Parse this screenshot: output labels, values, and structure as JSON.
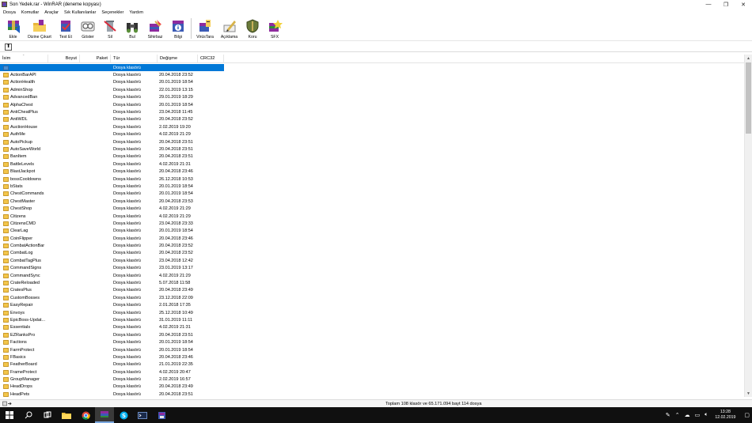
{
  "window": {
    "title": "Son Yedek.rar - WinRAR (deneme kopyası)",
    "minimize": "—",
    "maximize": "❐",
    "close": "✕"
  },
  "menu": [
    "Dosya",
    "Komutlar",
    "Araçlar",
    "Sık Kullanılanlar",
    "Seçenekler",
    "Yardım"
  ],
  "toolbar": [
    {
      "label": "Ekle",
      "icon": "add-archive-icon"
    },
    {
      "label": "Dizine Çıkart",
      "icon": "extract-to-icon"
    },
    {
      "label": "Test Et",
      "icon": "test-icon"
    },
    {
      "label": "Göster",
      "icon": "view-icon"
    },
    {
      "label": "Sil",
      "icon": "delete-icon"
    },
    {
      "label": "Bul",
      "icon": "find-icon"
    },
    {
      "label": "Sihirbaz",
      "icon": "wizard-icon"
    },
    {
      "label": "Bilgi",
      "icon": "info-icon"
    },
    {
      "label": "VirüsTara",
      "icon": "virus-scan-icon"
    },
    {
      "label": "Açıklama",
      "icon": "comment-icon"
    },
    {
      "label": "Koru",
      "icon": "protect-icon"
    },
    {
      "label": "SFX",
      "icon": "sfx-icon"
    }
  ],
  "path_bar": {
    "up_glyph": "⬆"
  },
  "columns": {
    "name": "İsim",
    "size": "Boyut",
    "packed": "Paket",
    "type": "Tür",
    "modified": "Değişme",
    "crc": "CRC32"
  },
  "rows": [
    {
      "name": "",
      "type": "Dosya klasörü",
      "modified": "",
      "selected": true,
      "up": true
    },
    {
      "name": "ActionBarAPI",
      "type": "Dosya klasörü",
      "modified": "20.04.2018 23:52"
    },
    {
      "name": "ActionHealth",
      "type": "Dosya klasörü",
      "modified": "20.01.2019 18:54"
    },
    {
      "name": "AdminShop",
      "type": "Dosya klasörü",
      "modified": "22.01.2019 13:15"
    },
    {
      "name": "AdvancedBan",
      "type": "Dosya klasörü",
      "modified": "29.01.2019 18:29"
    },
    {
      "name": "AlphaChest",
      "type": "Dosya klasörü",
      "modified": "20.01.2019 18:54"
    },
    {
      "name": "AntiCheatPlus",
      "type": "Dosya klasörü",
      "modified": "23.04.2018 11:45"
    },
    {
      "name": "AntiWDL",
      "type": "Dosya klasörü",
      "modified": "20.04.2018 23:52"
    },
    {
      "name": "AuctionHouse",
      "type": "Dosya klasörü",
      "modified": "2.02.2019 19:20"
    },
    {
      "name": "AuthMe",
      "type": "Dosya klasörü",
      "modified": "4.02.2019 21:29"
    },
    {
      "name": "AutoPickup",
      "type": "Dosya klasörü",
      "modified": "20.04.2018 23:51"
    },
    {
      "name": "AutoSaveWorld",
      "type": "Dosya klasörü",
      "modified": "20.04.2018 23:51"
    },
    {
      "name": "BanItem",
      "type": "Dosya klasörü",
      "modified": "20.04.2018 23:51"
    },
    {
      "name": "BattleLevels",
      "type": "Dosya klasörü",
      "modified": "4.02.2019 21:31"
    },
    {
      "name": "BlastJackpot",
      "type": "Dosya klasörü",
      "modified": "20.04.2018 23:46"
    },
    {
      "name": "bossCooldowns",
      "type": "Dosya klasörü",
      "modified": "26.12.2018 10:53"
    },
    {
      "name": "bStats",
      "type": "Dosya klasörü",
      "modified": "20.01.2019 18:54"
    },
    {
      "name": "ChestCommands",
      "type": "Dosya klasörü",
      "modified": "20.01.2019 18:54"
    },
    {
      "name": "ChestMaster",
      "type": "Dosya klasörü",
      "modified": "20.04.2018 23:53"
    },
    {
      "name": "ChestShop",
      "type": "Dosya klasörü",
      "modified": "4.02.2019 21:29"
    },
    {
      "name": "Citizens",
      "type": "Dosya klasörü",
      "modified": "4.02.2019 21:29"
    },
    {
      "name": "CitizensCMD",
      "type": "Dosya klasörü",
      "modified": "23.04.2018 23:33"
    },
    {
      "name": "ClearLag",
      "type": "Dosya klasörü",
      "modified": "20.01.2019 18:54"
    },
    {
      "name": "CoinFlipper",
      "type": "Dosya klasörü",
      "modified": "20.04.2018 23:46"
    },
    {
      "name": "CombatActionBar",
      "type": "Dosya klasörü",
      "modified": "20.04.2018 23:52"
    },
    {
      "name": "CombatLog",
      "type": "Dosya klasörü",
      "modified": "20.04.2018 23:52"
    },
    {
      "name": "CombatTagPlus",
      "type": "Dosya klasörü",
      "modified": "23.04.2018 12:42"
    },
    {
      "name": "CommandSigns",
      "type": "Dosya klasörü",
      "modified": "23.01.2019 13:17"
    },
    {
      "name": "CommandSync",
      "type": "Dosya klasörü",
      "modified": "4.02.2019 21:29"
    },
    {
      "name": "CrateReloaded",
      "type": "Dosya klasörü",
      "modified": "5.07.2018 11:58"
    },
    {
      "name": "CratesPlus",
      "type": "Dosya klasörü",
      "modified": "20.04.2018 23:49"
    },
    {
      "name": "CustomBosses",
      "type": "Dosya klasörü",
      "modified": "23.12.2018 22:09"
    },
    {
      "name": "EasyRepair",
      "type": "Dosya klasörü",
      "modified": "2.01.2018 17:35"
    },
    {
      "name": "Envoys",
      "type": "Dosya klasörü",
      "modified": "25.12.2018 10:49"
    },
    {
      "name": "EpicBoss-Updat...",
      "type": "Dosya klasörü",
      "modified": "31.01.2019 11:11"
    },
    {
      "name": "Essentials",
      "type": "Dosya klasörü",
      "modified": "4.02.2019 21:31"
    },
    {
      "name": "EZRanksPro",
      "type": "Dosya klasörü",
      "modified": "20.04.2018 23:51"
    },
    {
      "name": "Factions",
      "type": "Dosya klasörü",
      "modified": "20.01.2019 18:54"
    },
    {
      "name": "FarmProtect",
      "type": "Dosya klasörü",
      "modified": "20.01.2019 18:54"
    },
    {
      "name": "FBasics",
      "type": "Dosya klasörü",
      "modified": "20.04.2018 23:46"
    },
    {
      "name": "FeatherBoard",
      "type": "Dosya klasörü",
      "modified": "21.01.2019 22:35"
    },
    {
      "name": "FrameProtect",
      "type": "Dosya klasörü",
      "modified": "4.02.2019 20:47"
    },
    {
      "name": "GroupManager",
      "type": "Dosya klasörü",
      "modified": "2.02.2019 16:57"
    },
    {
      "name": "HeadDrops",
      "type": "Dosya klasörü",
      "modified": "20.04.2018 23:49"
    },
    {
      "name": "HeadPets",
      "type": "Dosya klasörü",
      "modified": "20.04.2018 23:51"
    }
  ],
  "status": {
    "text": "Toplam 108 klasör ve 65.171.094 bayt 114 dosya"
  },
  "taskbar": {
    "apps": [
      "start-icon",
      "search-icon",
      "task-view-icon",
      "file-explorer-icon",
      "chrome-icon",
      "winrar-icon",
      "skype-icon",
      "terminal-icon",
      "app-icon"
    ],
    "time": "13:28",
    "date": "12.02.2019"
  }
}
